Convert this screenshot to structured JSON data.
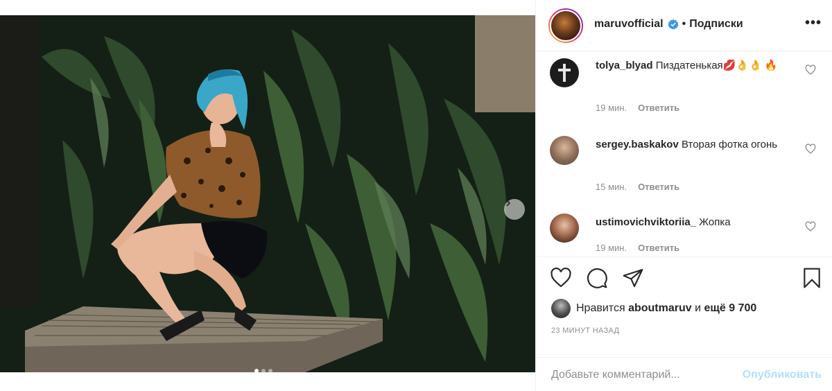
{
  "post": {
    "author": "maruvofficial",
    "follow_label": "Подписки",
    "separator": "•",
    "more_label": "•••"
  },
  "comments": [
    {
      "username": "tolya_blyad",
      "text": "Пиздатенькая💋👌👌 🔥",
      "time": "19 мин.",
      "reply_label": "Ответить"
    },
    {
      "username": "sergey.baskakov",
      "text": "Вторая фотка огонь",
      "time": "15 мин.",
      "reply_label": "Ответить"
    },
    {
      "username": "ustimovichviktoriia_",
      "text": "Жопка",
      "time": "19 мин.",
      "reply_label": "Ответить"
    }
  ],
  "likes": {
    "prefix": "Нравится",
    "user": "aboutmaruv",
    "joiner": "и",
    "others": "ещё 9 700"
  },
  "time_ago": "23 МИНУТ НАЗАД",
  "add_comment": {
    "placeholder": "Добавьте комментарий...",
    "publish_label": "Опубликовать"
  },
  "carousel": {
    "total": 3,
    "active": 0
  },
  "colors": {
    "verified": "#3897f0",
    "publish_disabled": "#b2dffc",
    "meta_gray": "#8e8e8e",
    "border": "#efefef"
  },
  "icons": {
    "like": "heart-icon",
    "comment": "comment-icon",
    "share": "paper-plane-icon",
    "save": "bookmark-icon",
    "next": "chevron-right-icon",
    "verified": "verified-badge-icon"
  }
}
